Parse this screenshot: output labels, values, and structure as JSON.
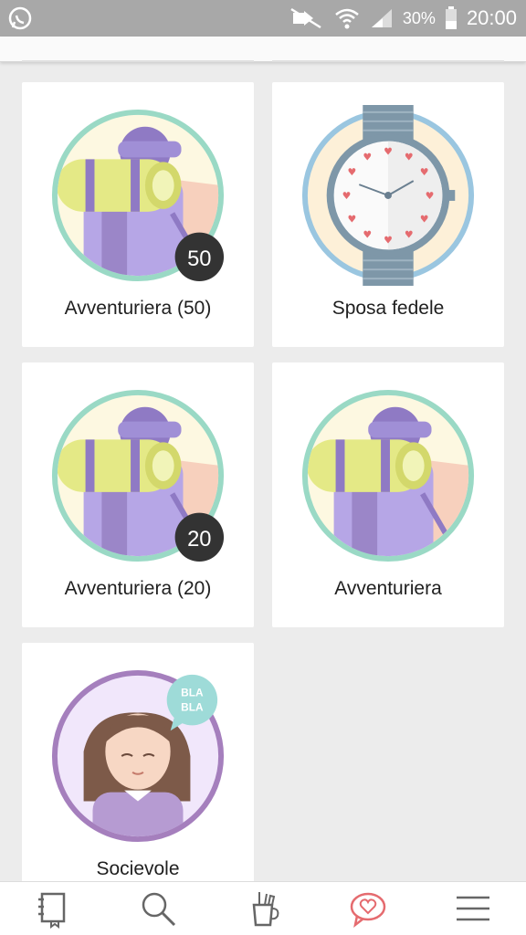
{
  "status_bar": {
    "battery": "30%",
    "time": "20:00"
  },
  "cards": [
    {
      "label": "Avventuriera (50)",
      "count": "50"
    },
    {
      "label": "Sposa fedele"
    },
    {
      "label": "Avventuriera (20)",
      "count": "20"
    },
    {
      "label": "Avventuriera"
    },
    {
      "label": "Socievole",
      "bubble_line1": "BLA",
      "bubble_line2": "BLA"
    }
  ],
  "bottom_nav": [
    "notebook-icon",
    "search-icon",
    "tools-icon",
    "chat-heart-icon",
    "menu-icon"
  ],
  "colors": {
    "heart_accent": "#e56b6f",
    "nav_icon": "#666666",
    "teal_ring": "#9ad9c5",
    "lilac": "#9b86c8"
  }
}
